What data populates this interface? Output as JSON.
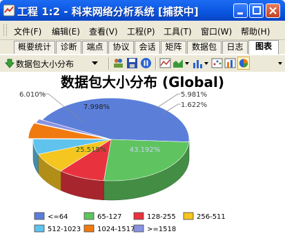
{
  "window": {
    "title": "工程 1:2 - 科来网络分析系统 [捕获中]"
  },
  "menu": [
    "文件(F)",
    "编辑(E)",
    "查看(V)",
    "工程(P)",
    "工具(T)",
    "窗口(W)",
    "帮助(H)"
  ],
  "tabs": [
    "概要统计",
    "诊断",
    "端点",
    "协议",
    "会话",
    "矩阵",
    "数据包",
    "日志",
    "图表"
  ],
  "active_tab": "图表",
  "toolbar": {
    "view_selector": "数据包大小分布"
  },
  "colors": {
    "titlebar": "#0a55e0",
    "chrome": "#ece9d8"
  },
  "chart_data": {
    "type": "pie",
    "title": "数据包大小分布 (Global)",
    "three_d": true,
    "legend_position": "bottom",
    "slices": [
      {
        "label": "<=64",
        "value": 43.192,
        "value_label": "43.192%",
        "color": "#5b7fd9"
      },
      {
        "label": "65-127",
        "value": 25.515,
        "value_label": "25.515%",
        "color": "#5fc45f"
      },
      {
        "label": "128-255",
        "value": 9.682,
        "value_label": "",
        "color": "#e8333f"
      },
      {
        "label": "256-511",
        "value": 7.998,
        "value_label": "7.998%",
        "color": "#f5c520"
      },
      {
        "label": "512-1023",
        "value": 6.01,
        "value_label": "6.010%",
        "color": "#5fc3ee"
      },
      {
        "label": "1024-1517",
        "value": 5.981,
        "value_label": "5.981%",
        "color": "#f07a10"
      },
      {
        "label": ">=1518",
        "value": 1.622,
        "value_label": "1.622%",
        "color": "#8a93e0"
      }
    ]
  }
}
